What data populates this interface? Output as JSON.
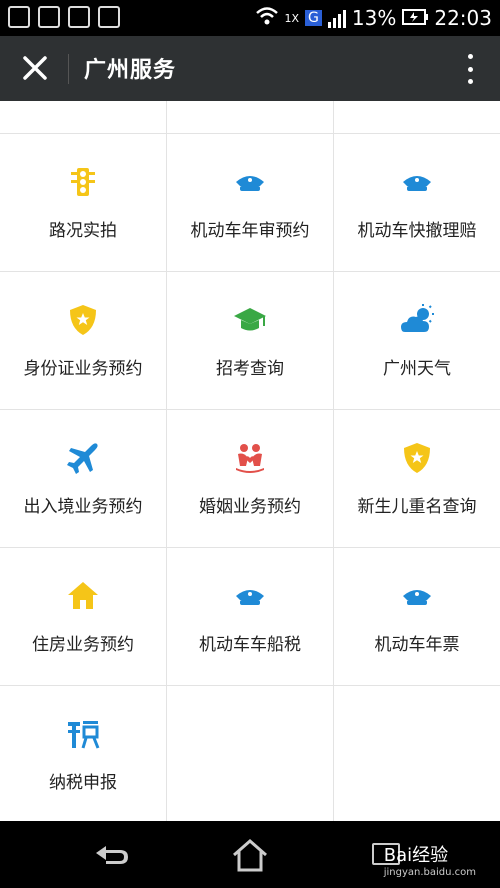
{
  "statusbar": {
    "battery": "13%",
    "time": "22:03",
    "net_type": "G",
    "rx_label": "1X"
  },
  "header": {
    "title": "广州服务"
  },
  "grid": {
    "rows": [
      [
        {
          "label": "路况实拍",
          "icon": "traffic-light-icon"
        },
        {
          "label": "机动车年审预约",
          "icon": "police-cap-icon"
        },
        {
          "label": "机动车快撤理赔",
          "icon": "police-cap-icon"
        }
      ],
      [
        {
          "label": "身份证业务预约",
          "icon": "police-badge-icon"
        },
        {
          "label": "招考查询",
          "icon": "graduation-cap-icon"
        },
        {
          "label": "广州天气",
          "icon": "weather-icon"
        }
      ],
      [
        {
          "label": "出入境业务预约",
          "icon": "airplane-icon"
        },
        {
          "label": "婚姻业务预约",
          "icon": "marriage-icon"
        },
        {
          "label": "新生儿重名查询",
          "icon": "police-badge-icon"
        }
      ],
      [
        {
          "label": "住房业务预约",
          "icon": "house-icon"
        },
        {
          "label": "机动车车船税",
          "icon": "police-cap-icon"
        },
        {
          "label": "机动车年票",
          "icon": "police-cap-icon"
        }
      ],
      [
        {
          "label": "纳税申报",
          "icon": "tax-icon"
        }
      ]
    ]
  },
  "watermark": {
    "text": "Bai经验",
    "sub": "jingyan.baidu.com"
  },
  "colors": {
    "blue": "#1f8ad6",
    "yellow": "#f5c518",
    "green": "#3aa845",
    "red": "#e2504a"
  }
}
